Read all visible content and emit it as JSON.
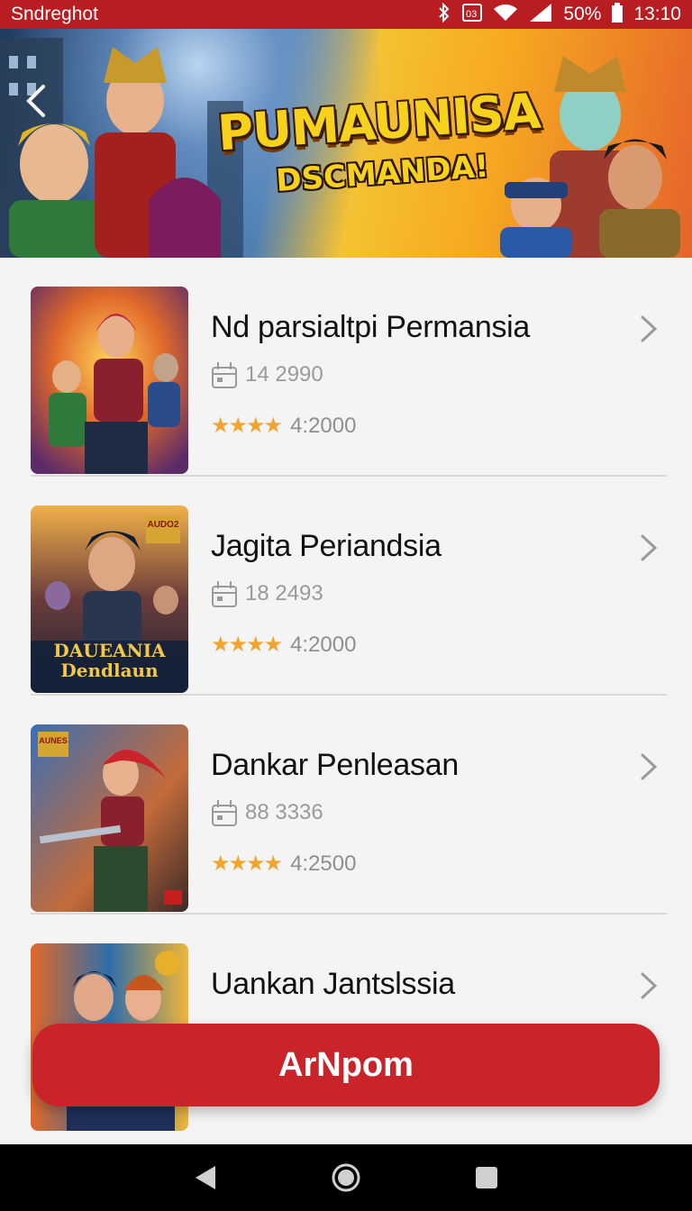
{
  "status_bar": {
    "app_name": "Sndreghot",
    "battery": "50%",
    "time": "13:10",
    "icons": [
      "bluetooth-icon",
      "nfc-icon",
      "wifi-icon",
      "signal-icon",
      "battery-icon"
    ]
  },
  "banner": {
    "title_line1": "PUMAUNISA",
    "title_line2": "DSCMANDA!"
  },
  "list": {
    "items": [
      {
        "title": "Nd parsialtpi Permansia",
        "count": "14 2990",
        "stars": "★★★★",
        "score": "4:2000",
        "thumb_badge": ""
      },
      {
        "title": "Jagita Periandsia",
        "count": "18 2493",
        "stars": "★★★★",
        "score": "4:2000",
        "thumb_badge": "AUDO2",
        "thumb_caption": "DAUEANIA Dendlaun"
      },
      {
        "title": "Dankar Penleasan",
        "count": "88 3336",
        "stars": "★★★★",
        "score": "4:2500",
        "thumb_badge": "AUNES"
      },
      {
        "title": "Uankan Jantslssia",
        "count": "",
        "stars": "",
        "score": "",
        "thumb_badge": ""
      }
    ]
  },
  "action_button": {
    "label": "ArNpom"
  },
  "colors": {
    "brand": "#c8242a",
    "status_bar": "#b81d22",
    "star": "#f0a531"
  }
}
